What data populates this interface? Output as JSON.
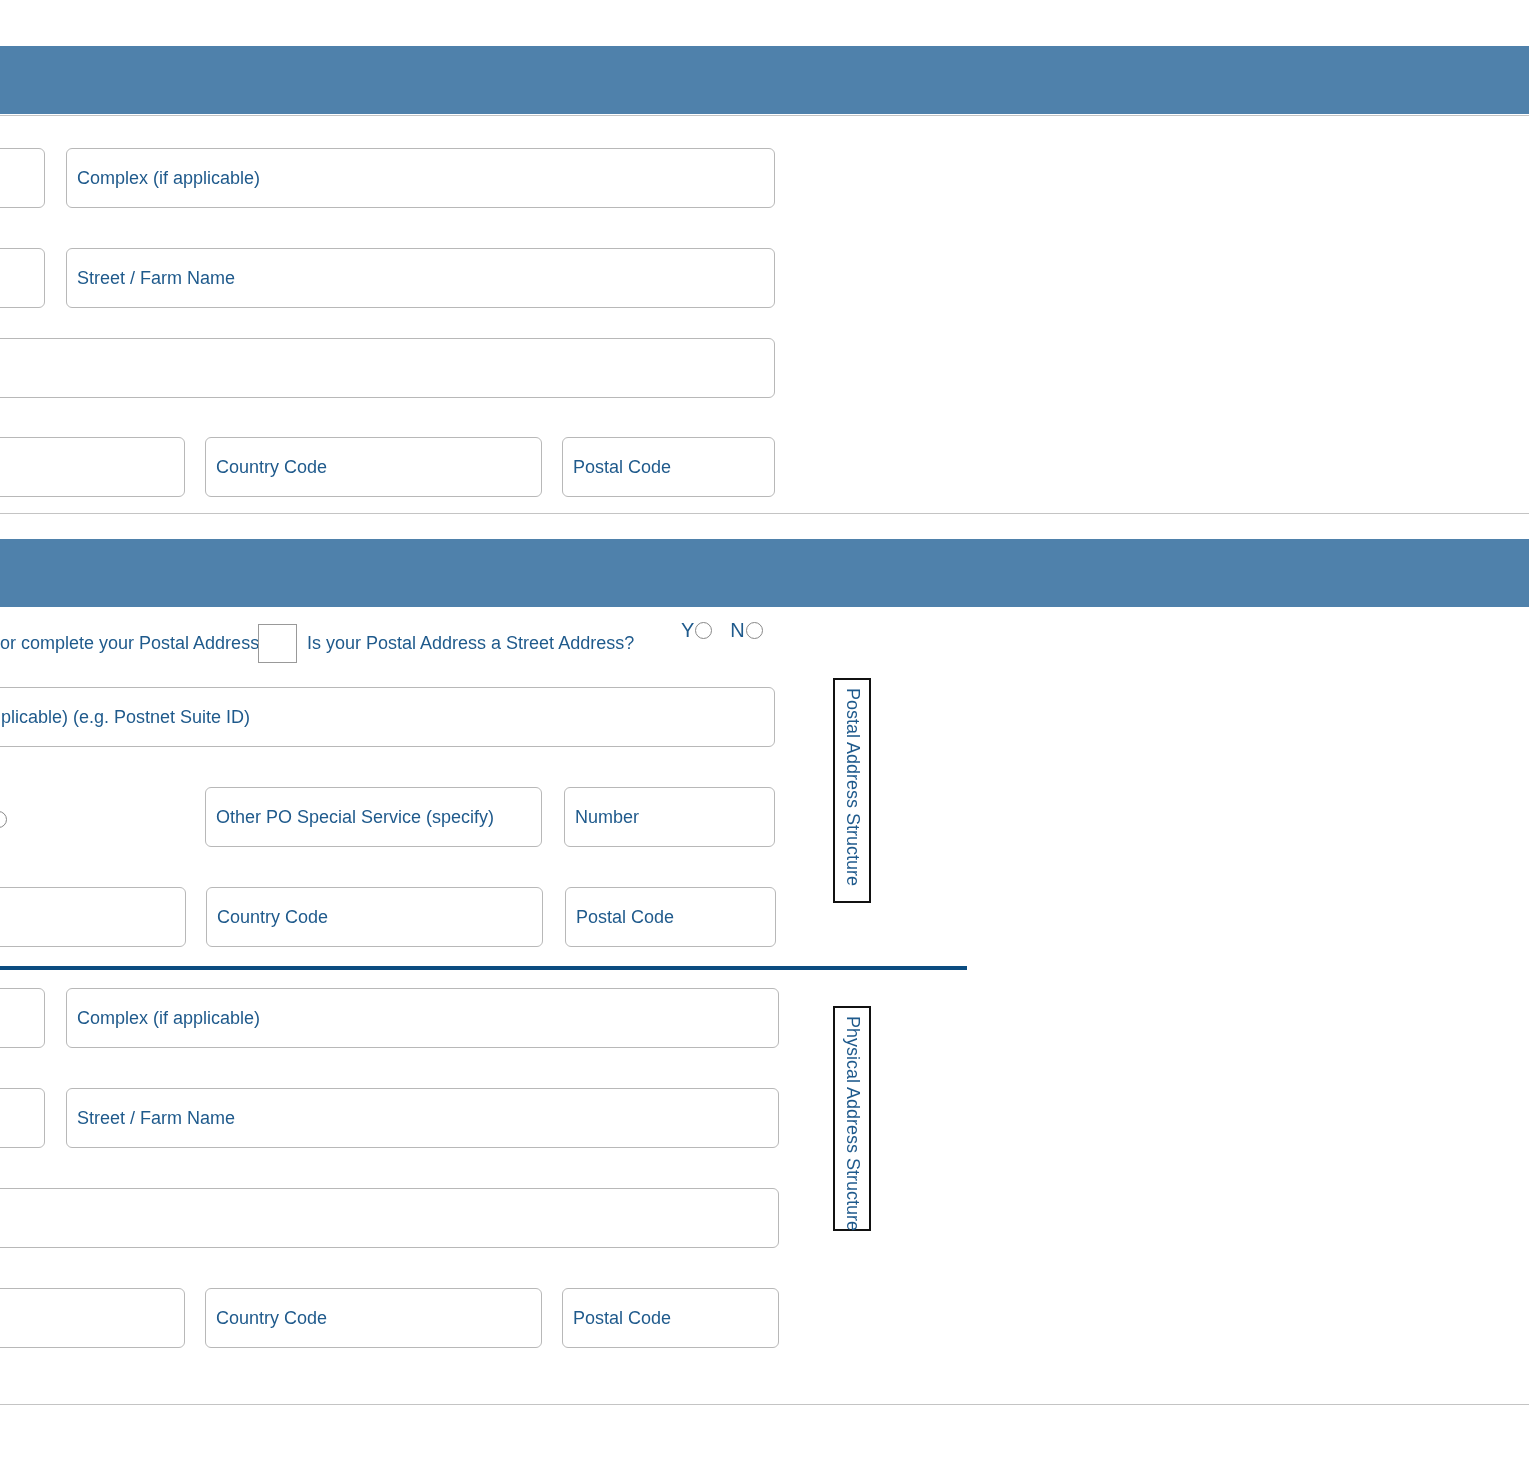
{
  "street_address_top": {
    "complex": {
      "placeholder": "Complex (if applicable)"
    },
    "street": {
      "placeholder": "Street / Farm Name"
    },
    "country_code": {
      "placeholder": "Country Code"
    },
    "postal_code": {
      "placeholder": "Postal Code"
    }
  },
  "postal_address": {
    "instruction": "or complete your Postal Address",
    "same_as_checkbox": {
      "checked": false
    },
    "question": "Is your Postal Address a Street Address?",
    "answer_options": [
      {
        "label": "Y",
        "selected": false
      },
      {
        "label": "N",
        "selected": false
      }
    ],
    "suite": {
      "placeholder": "plicable) (e.g. Postnet Suite ID)"
    },
    "service_option": {
      "selected": false
    },
    "special_service": {
      "placeholder": "Other PO Special Service (specify)"
    },
    "number": {
      "placeholder": "Number"
    },
    "country_code": {
      "placeholder": "Country Code"
    },
    "postal_code": {
      "placeholder": "Postal Code"
    },
    "side_label": "Postal Address Structure"
  },
  "physical_address": {
    "complex": {
      "placeholder": "Complex (if applicable)"
    },
    "street": {
      "placeholder": "Street / Farm Name"
    },
    "country_code": {
      "placeholder": "Country Code"
    },
    "postal_code": {
      "placeholder": "Postal Code"
    },
    "side_label": "Physical Address Structure"
  }
}
